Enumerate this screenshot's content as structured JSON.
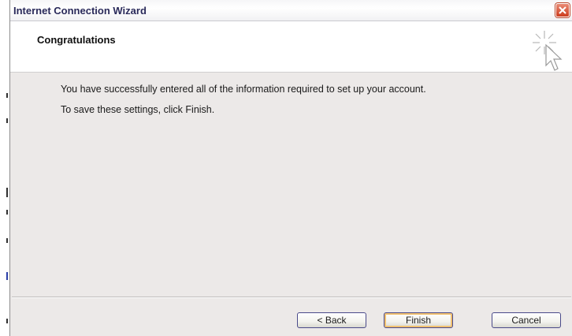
{
  "window": {
    "title": "Internet Connection Wizard"
  },
  "header": {
    "title": "Congratulations"
  },
  "body": {
    "line1": "You have successfully entered all of the information required to set up your account.",
    "line2": "To save these settings, click Finish."
  },
  "buttons": {
    "back": "< Back",
    "finish": "Finish",
    "cancel": "Cancel"
  },
  "icons": {
    "close": "close-icon",
    "wizard": "sparkle-cursor-icon"
  },
  "colors": {
    "window_bg": "#ece9e8",
    "header_bg": "#ffffff",
    "close_red": "#cc3c1d",
    "default_button_glow": "#f0c070"
  }
}
